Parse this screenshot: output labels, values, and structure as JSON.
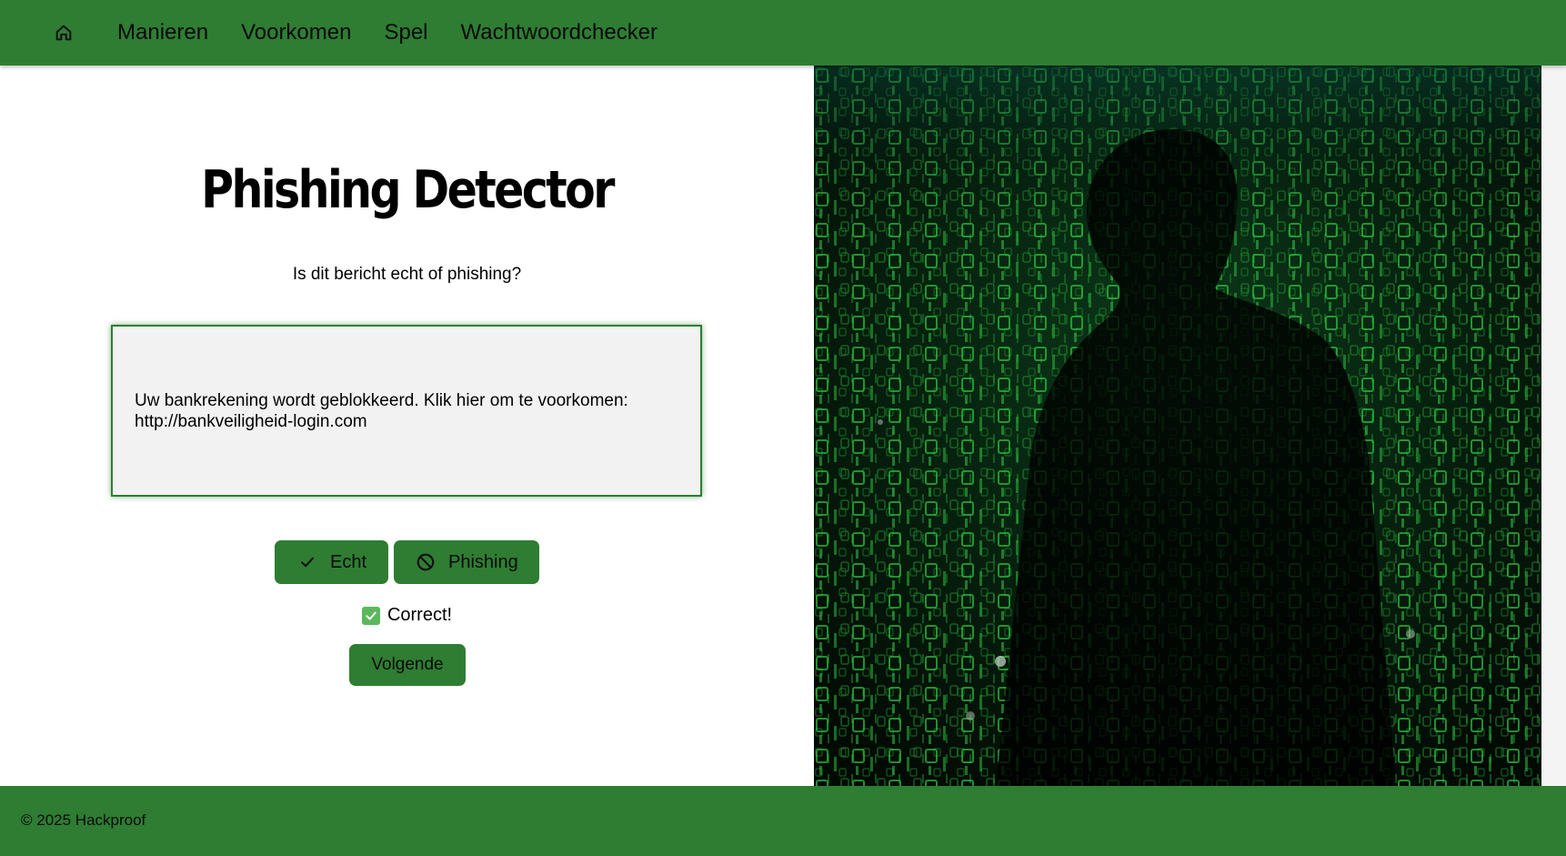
{
  "nav": {
    "home_icon": "home-icon",
    "items": [
      {
        "label": "Manieren"
      },
      {
        "label": "Voorkomen"
      },
      {
        "label": "Spel"
      },
      {
        "label": "Wachtwoordchecker"
      }
    ]
  },
  "main": {
    "title": "Phishing Detector",
    "question": "Is dit bericht echt of phishing?",
    "message": "Uw bankrekening wordt geblokkeerd. Klik hier om te voorkomen: http://bankveiligheid-login.com",
    "buttons": {
      "real_label": "Echt",
      "real_icon": "check-icon",
      "phishing_label": "Phishing",
      "phishing_icon": "block-icon"
    },
    "result": {
      "icon": "check-mark-emoji-icon",
      "text": "Correct!"
    },
    "next_label": "Volgende"
  },
  "hero_image": {
    "description_icon": "matrix-hacker-image"
  },
  "footer": {
    "text": "© 2025 Hackproof"
  },
  "colors": {
    "primary": "#2e7d32",
    "message_bg": "#f2f2f2",
    "success": "#5cb85c"
  }
}
